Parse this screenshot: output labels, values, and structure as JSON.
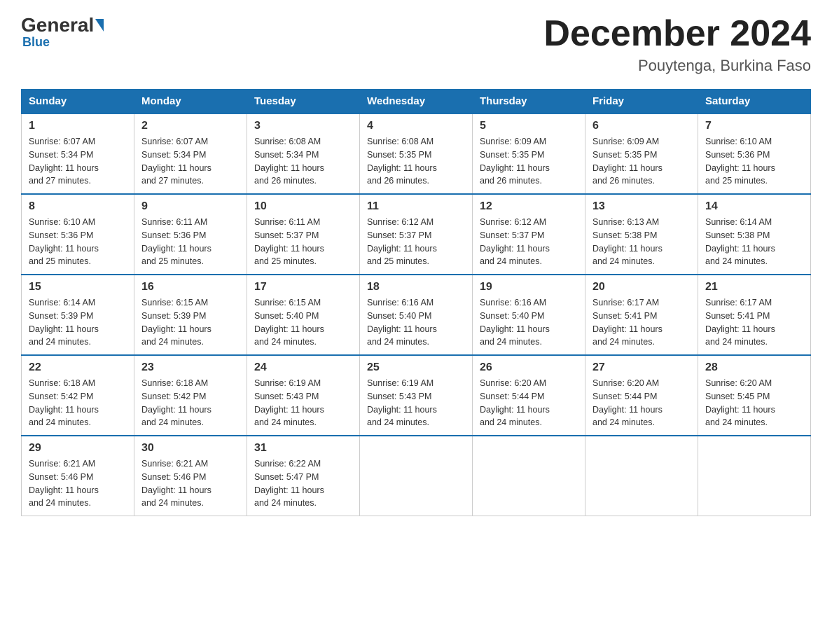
{
  "logo": {
    "general": "General",
    "blue": "Blue"
  },
  "header": {
    "month": "December 2024",
    "location": "Pouytenga, Burkina Faso"
  },
  "days_of_week": [
    "Sunday",
    "Monday",
    "Tuesday",
    "Wednesday",
    "Thursday",
    "Friday",
    "Saturday"
  ],
  "weeks": [
    [
      {
        "day": "1",
        "sunrise": "6:07 AM",
        "sunset": "5:34 PM",
        "daylight": "11 hours and 27 minutes."
      },
      {
        "day": "2",
        "sunrise": "6:07 AM",
        "sunset": "5:34 PM",
        "daylight": "11 hours and 27 minutes."
      },
      {
        "day": "3",
        "sunrise": "6:08 AM",
        "sunset": "5:34 PM",
        "daylight": "11 hours and 26 minutes."
      },
      {
        "day": "4",
        "sunrise": "6:08 AM",
        "sunset": "5:35 PM",
        "daylight": "11 hours and 26 minutes."
      },
      {
        "day": "5",
        "sunrise": "6:09 AM",
        "sunset": "5:35 PM",
        "daylight": "11 hours and 26 minutes."
      },
      {
        "day": "6",
        "sunrise": "6:09 AM",
        "sunset": "5:35 PM",
        "daylight": "11 hours and 26 minutes."
      },
      {
        "day": "7",
        "sunrise": "6:10 AM",
        "sunset": "5:36 PM",
        "daylight": "11 hours and 25 minutes."
      }
    ],
    [
      {
        "day": "8",
        "sunrise": "6:10 AM",
        "sunset": "5:36 PM",
        "daylight": "11 hours and 25 minutes."
      },
      {
        "day": "9",
        "sunrise": "6:11 AM",
        "sunset": "5:36 PM",
        "daylight": "11 hours and 25 minutes."
      },
      {
        "day": "10",
        "sunrise": "6:11 AM",
        "sunset": "5:37 PM",
        "daylight": "11 hours and 25 minutes."
      },
      {
        "day": "11",
        "sunrise": "6:12 AM",
        "sunset": "5:37 PM",
        "daylight": "11 hours and 25 minutes."
      },
      {
        "day": "12",
        "sunrise": "6:12 AM",
        "sunset": "5:37 PM",
        "daylight": "11 hours and 24 minutes."
      },
      {
        "day": "13",
        "sunrise": "6:13 AM",
        "sunset": "5:38 PM",
        "daylight": "11 hours and 24 minutes."
      },
      {
        "day": "14",
        "sunrise": "6:14 AM",
        "sunset": "5:38 PM",
        "daylight": "11 hours and 24 minutes."
      }
    ],
    [
      {
        "day": "15",
        "sunrise": "6:14 AM",
        "sunset": "5:39 PM",
        "daylight": "11 hours and 24 minutes."
      },
      {
        "day": "16",
        "sunrise": "6:15 AM",
        "sunset": "5:39 PM",
        "daylight": "11 hours and 24 minutes."
      },
      {
        "day": "17",
        "sunrise": "6:15 AM",
        "sunset": "5:40 PM",
        "daylight": "11 hours and 24 minutes."
      },
      {
        "day": "18",
        "sunrise": "6:16 AM",
        "sunset": "5:40 PM",
        "daylight": "11 hours and 24 minutes."
      },
      {
        "day": "19",
        "sunrise": "6:16 AM",
        "sunset": "5:40 PM",
        "daylight": "11 hours and 24 minutes."
      },
      {
        "day": "20",
        "sunrise": "6:17 AM",
        "sunset": "5:41 PM",
        "daylight": "11 hours and 24 minutes."
      },
      {
        "day": "21",
        "sunrise": "6:17 AM",
        "sunset": "5:41 PM",
        "daylight": "11 hours and 24 minutes."
      }
    ],
    [
      {
        "day": "22",
        "sunrise": "6:18 AM",
        "sunset": "5:42 PM",
        "daylight": "11 hours and 24 minutes."
      },
      {
        "day": "23",
        "sunrise": "6:18 AM",
        "sunset": "5:42 PM",
        "daylight": "11 hours and 24 minutes."
      },
      {
        "day": "24",
        "sunrise": "6:19 AM",
        "sunset": "5:43 PM",
        "daylight": "11 hours and 24 minutes."
      },
      {
        "day": "25",
        "sunrise": "6:19 AM",
        "sunset": "5:43 PM",
        "daylight": "11 hours and 24 minutes."
      },
      {
        "day": "26",
        "sunrise": "6:20 AM",
        "sunset": "5:44 PM",
        "daylight": "11 hours and 24 minutes."
      },
      {
        "day": "27",
        "sunrise": "6:20 AM",
        "sunset": "5:44 PM",
        "daylight": "11 hours and 24 minutes."
      },
      {
        "day": "28",
        "sunrise": "6:20 AM",
        "sunset": "5:45 PM",
        "daylight": "11 hours and 24 minutes."
      }
    ],
    [
      {
        "day": "29",
        "sunrise": "6:21 AM",
        "sunset": "5:46 PM",
        "daylight": "11 hours and 24 minutes."
      },
      {
        "day": "30",
        "sunrise": "6:21 AM",
        "sunset": "5:46 PM",
        "daylight": "11 hours and 24 minutes."
      },
      {
        "day": "31",
        "sunrise": "6:22 AM",
        "sunset": "5:47 PM",
        "daylight": "11 hours and 24 minutes."
      },
      null,
      null,
      null,
      null
    ]
  ],
  "labels": {
    "sunrise_prefix": "Sunrise: ",
    "sunset_prefix": "Sunset: ",
    "daylight_prefix": "Daylight: "
  }
}
